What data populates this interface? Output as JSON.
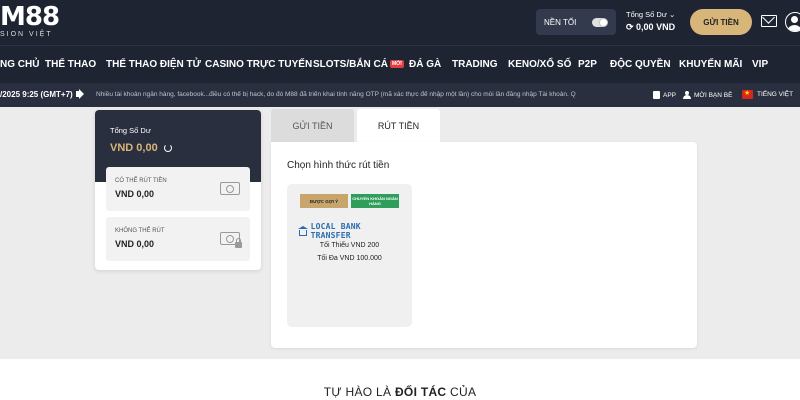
{
  "header": {
    "logo_main": "M88",
    "logo_sub": "SION VIỆT",
    "dark_mode_label": "NỀN TỐI",
    "balance_label": "Tổng Số Dư ⌄",
    "balance_value": "0,00 VND",
    "deposit_label": "GỬI TIỀN"
  },
  "nav": {
    "items": [
      {
        "label": "NG CHỦ"
      },
      {
        "label": "THỂ THAO"
      },
      {
        "label": "THỂ THAO ĐIỆN TỬ"
      },
      {
        "label": "CASINO TRỰC TUYẾN"
      },
      {
        "label": "SLOTS/BẮN CÁ",
        "badge": "MỚI"
      },
      {
        "label": "ĐÁ GÀ"
      },
      {
        "label": "TRADING"
      },
      {
        "label": "KENO/XỔ SỐ"
      },
      {
        "label": "P2P"
      },
      {
        "label": "ĐỘC QUYỀN"
      },
      {
        "label": "KHUYẾN MÃI"
      },
      {
        "label": "VIP"
      }
    ]
  },
  "ticker": {
    "datetime": "/2025 9:25 (GMT+7)",
    "message": "Nhiều tài khoản ngân hàng, facebook...điều có thể bị hack, do đó M88 đã triển khai tính năng OTP (mã xác thực để nhập một lần) cho mỗi lần đăng nhập Tài khoản. Q",
    "app_label": "APP",
    "referral_label": "MỜI BẠN BÈ",
    "language_label": "TIẾNG VIỆT"
  },
  "balance_panel": {
    "total_label": "Tổng Số Dư",
    "total_value": "VND 0,00",
    "withdrawable_label": "CÓ THỂ RÚT TIỀN",
    "withdrawable_value": "VND 0,00",
    "locked_label": "KHÔNG THỂ RÚT",
    "locked_value": "VND 0,00"
  },
  "tabs": {
    "deposit": "GỬI TIỀN",
    "withdraw": "RÚT TIỀN"
  },
  "withdraw": {
    "heading": "Chọn hình thức rút tiền",
    "method": {
      "tag_recommended": "ĐƯỢC GỢI Ý",
      "tag_type": "CHUYỂN KHOẢN NGÂN HÀNG",
      "name": "LOCAL BANK TRANSFER",
      "min": "Tối Thiểu VND 200",
      "max": "Tối Đa VND 100.000"
    }
  },
  "footer": {
    "title_prefix": "TỰ HÀO LÀ ",
    "title_bold": "ĐỐI TÁC",
    "title_suffix": " CỦA"
  },
  "colors": {
    "header_bg": "#1f2433",
    "gold": "#d8b679",
    "bank_green": "#2e9e5a",
    "bank_blue": "#2b6cb0",
    "new_badge": "#e23c3c"
  }
}
